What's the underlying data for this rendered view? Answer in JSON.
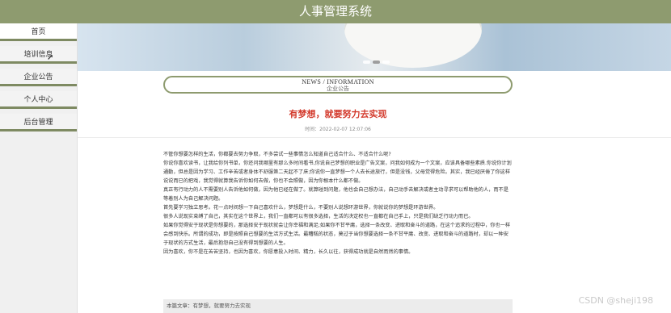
{
  "header": {
    "title": "人事管理系统"
  },
  "sidebar": {
    "items": [
      {
        "label": "首页",
        "active": true
      },
      {
        "label": "培训信息",
        "active": false
      },
      {
        "label": "企业公告",
        "active": false
      },
      {
        "label": "个人中心",
        "active": false
      },
      {
        "label": "后台管理",
        "active": false
      }
    ]
  },
  "section": {
    "title_en": "NEWS / INFORMATION",
    "title_cn": "企业公告"
  },
  "article": {
    "title": "有梦想，就要努力去实现",
    "time": "时间：2022-02-07 12:07:06",
    "paragraphs": [
      "不管你想要怎样的生活，你都要去努力争取，不多尝试一些事情怎么知道自己适合什么、不适合什么呢?",
      "你说你喜欢读书，让我给你列书单，你还问我哪里有那么多时间看书,你说自己梦想的职业是广告文案，问我如何成为一个文案，应该具备哪些素质.你说你计划通勤，但总是因为学习、工作辛苦或者身体不舒服第二天起不了床;你说你一直梦想一个人去长途旅行，但是没钱，父母觉得危险。其实，我已经厌倦了你这样说说而已的把戏，我觉得就算我告诉你如何去做，你也不会照做，因为你根本什么都不做。",
      "真正有行动力的人不需要别人告诉他如何做，因为他已经在做了。就算碰到问题，他也会自己想办法，自己动手去解决或者主动寻求可以帮助他的人，而不是等着别人为自己解决问题。",
      "首先要学习独立思考。花一点时间想一下自己喜欢什么，梦想是什么，不要别人说想环游世界，你就说你的梦想是环游世界。",
      "很多人说现实束缚了自己，其实在这个世界上，我们一直都可以有很多选择，生活的决定权也一直都在自己手上，只是我们缺乏行动力而已。",
      "如果你觉得安于现状是你想要的，那选择安于现状就会让你幸福和满足;如果你不甘平庸，选择一条改变、进取和奋斗的道路，在这个追求的过程中，你也一样会感到快乐。所谓的成功，即是按照自己想要的生活方式生活。最糟糕的状态，莫过于当你想要选择一条不甘平庸、改变、进取和奋斗的道路时，却以一种安于现状的方式生活，最后抱怨自己没有得到想要的人生。",
      "因为喜欢，你不是在苦苦坚持，也因为喜欢，你愿意投入时间、精力，长久以往，获得成功就是自然而然的事情。"
    ]
  },
  "related": {
    "text": "本篇文章：有梦想，就要努力去实现"
  },
  "watermark": {
    "text": "CSDN @sheji198"
  }
}
